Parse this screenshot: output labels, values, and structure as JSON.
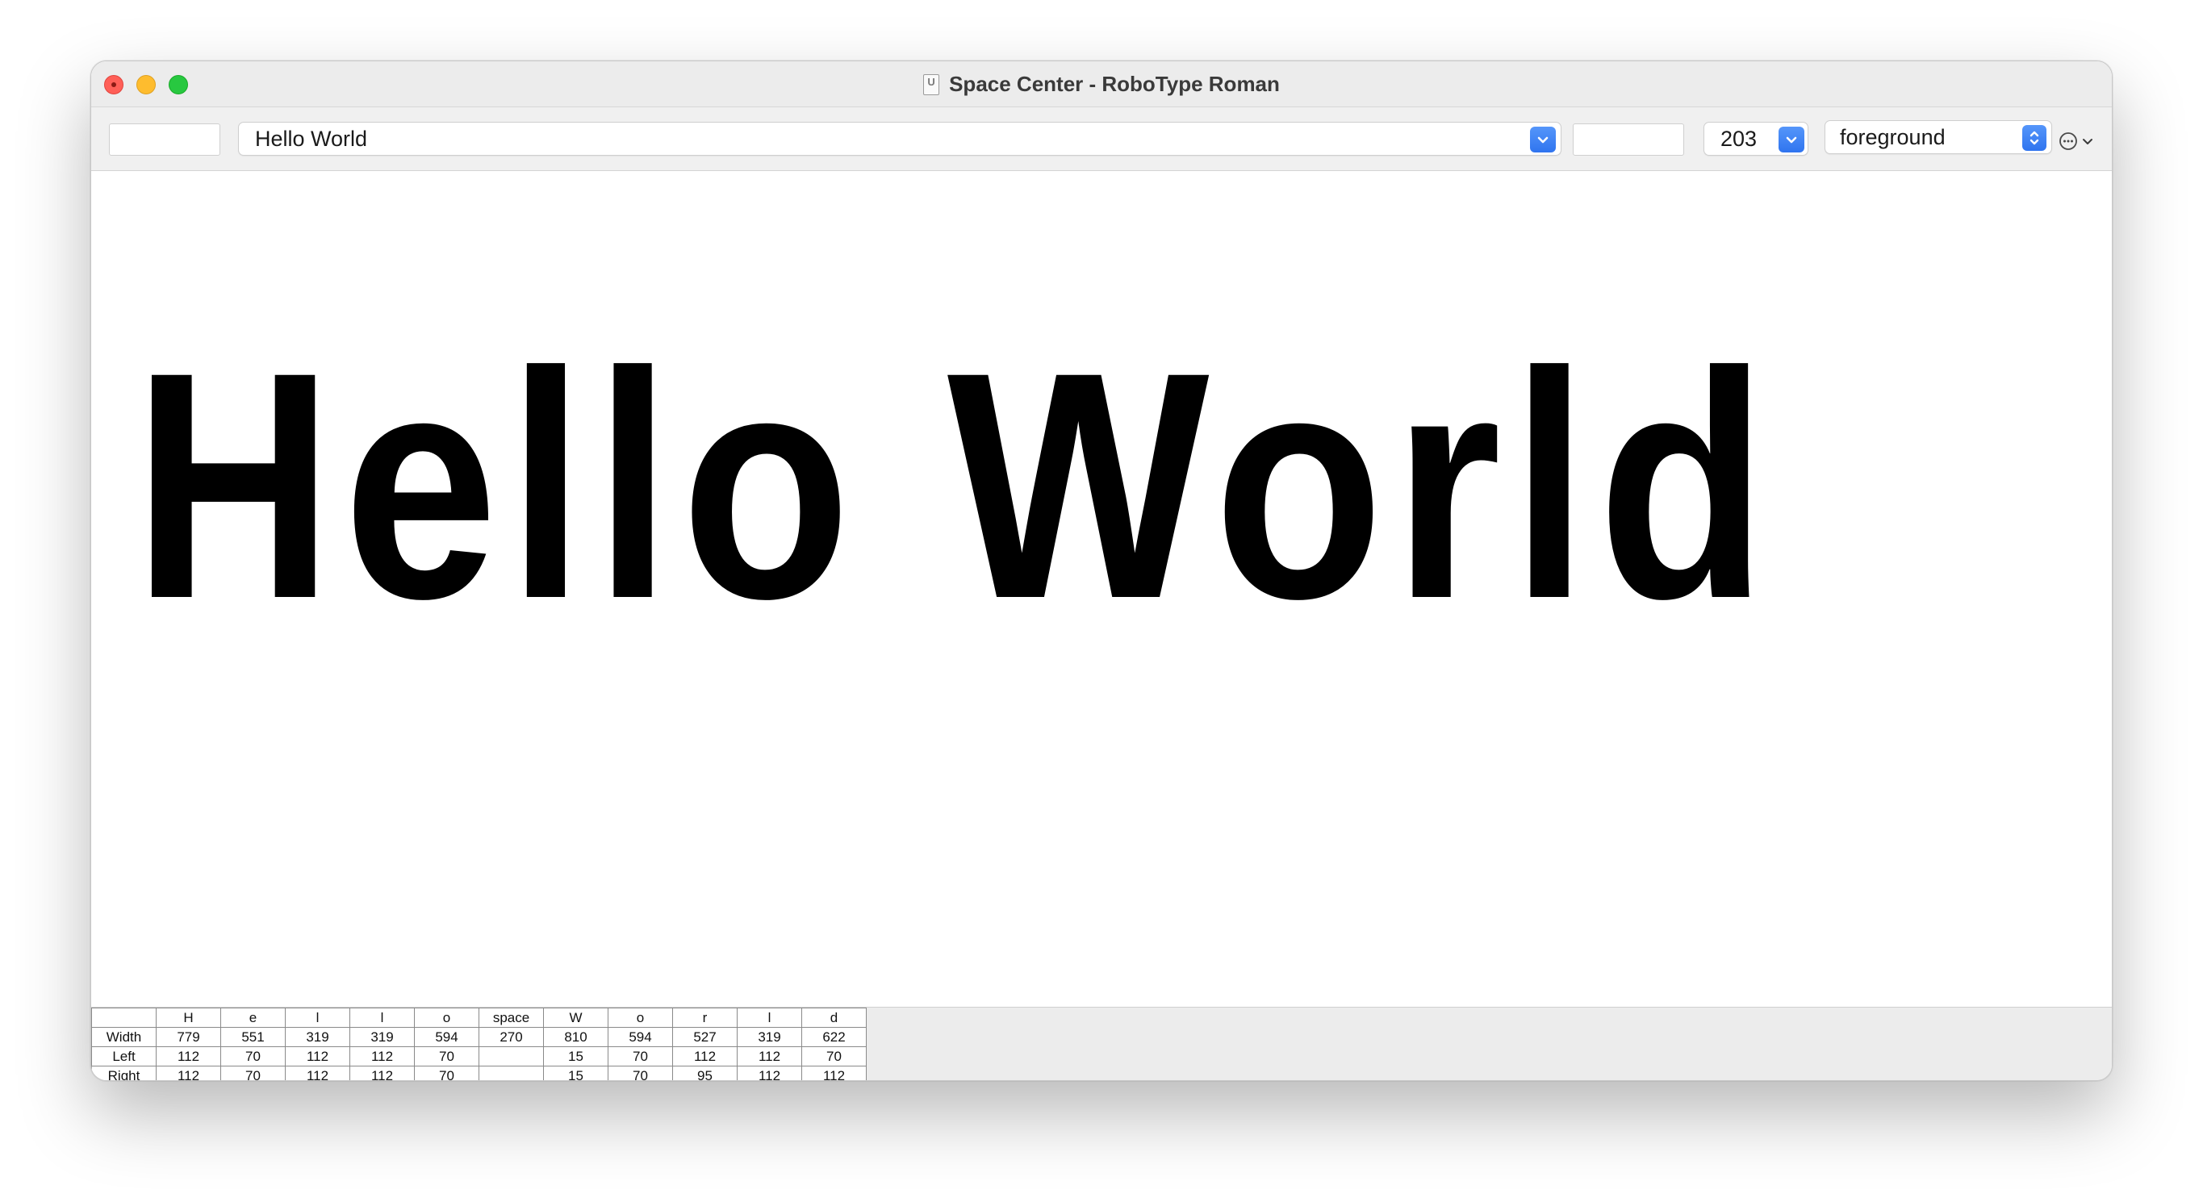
{
  "window": {
    "title": "Space Center - RoboType Roman",
    "title_icon": "ufo-document-icon"
  },
  "toolbar": {
    "left_field_value": "",
    "text_combo": {
      "value": "Hello World",
      "button_icon": "chevron-down-icon"
    },
    "middle_field_value": "",
    "size_combo": {
      "value": "203",
      "button_icon": "chevron-down-icon"
    },
    "layer_select": {
      "value": "foreground",
      "button_icon": "up-down-chevron-icon"
    },
    "more_icon": "ellipsis-circle-icon",
    "more_chevron_icon": "chevron-down-icon"
  },
  "preview": {
    "text": "Hello World",
    "color": "#000000"
  },
  "metrics": {
    "row_labels": [
      "Width",
      "Left",
      "Right"
    ],
    "glyphs": [
      {
        "name": "H",
        "width": "779",
        "left": "112",
        "right": "112"
      },
      {
        "name": "e",
        "width": "551",
        "left": "70",
        "right": "70"
      },
      {
        "name": "l",
        "width": "319",
        "left": "112",
        "right": "112"
      },
      {
        "name": "l",
        "width": "319",
        "left": "112",
        "right": "112"
      },
      {
        "name": "o",
        "width": "594",
        "left": "70",
        "right": "70"
      },
      {
        "name": "space",
        "width": "270",
        "left": "",
        "right": ""
      },
      {
        "name": "W",
        "width": "810",
        "left": "15",
        "right": "15"
      },
      {
        "name": "o",
        "width": "594",
        "left": "70",
        "right": "70"
      },
      {
        "name": "r",
        "width": "527",
        "left": "112",
        "right": "95"
      },
      {
        "name": "l",
        "width": "319",
        "left": "112",
        "right": "112"
      },
      {
        "name": "d",
        "width": "622",
        "left": "70",
        "right": "112"
      }
    ]
  },
  "colors": {
    "close": "#ff5f57",
    "minimize": "#febc2e",
    "maximize": "#28c840",
    "accent": "#3a82f7"
  }
}
